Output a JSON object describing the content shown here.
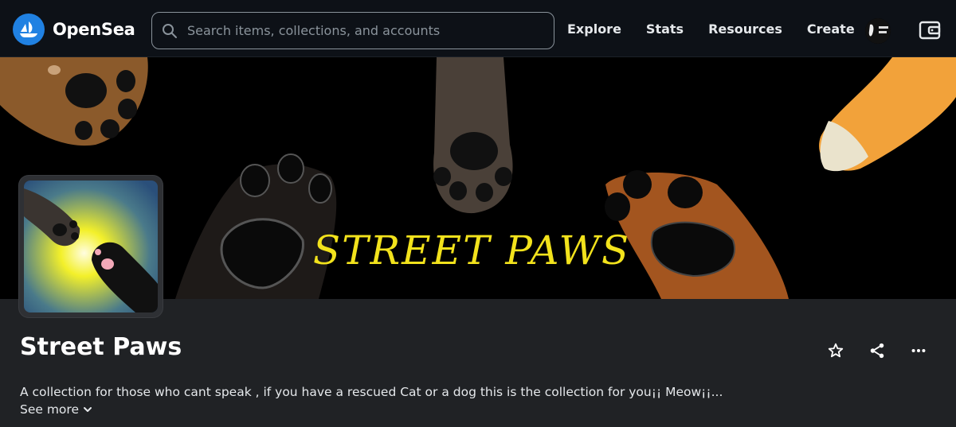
{
  "brand": {
    "name": "OpenSea",
    "accent": "#2081e2"
  },
  "search": {
    "placeholder": "Search items, collections, and accounts",
    "value": ""
  },
  "nav": {
    "links": [
      "Explore",
      "Stats",
      "Resources",
      "Create"
    ]
  },
  "banner": {
    "text": "STREET PAWS",
    "text_color": "#f2e21c"
  },
  "collection": {
    "name": "Street Paws",
    "description": "A collection for those who cant speak , if you have a rescued Cat or a dog this is the collection for you¡¡ Meow¡¡...",
    "see_more": "See more"
  },
  "icons": [
    "search-icon",
    "wallet-icon",
    "star-icon",
    "share-icon",
    "more-icon",
    "chevron-down-icon"
  ],
  "colors": {
    "nav_bg": "#0d1117",
    "page_bg": "#202225",
    "muted": "#8a939b"
  }
}
